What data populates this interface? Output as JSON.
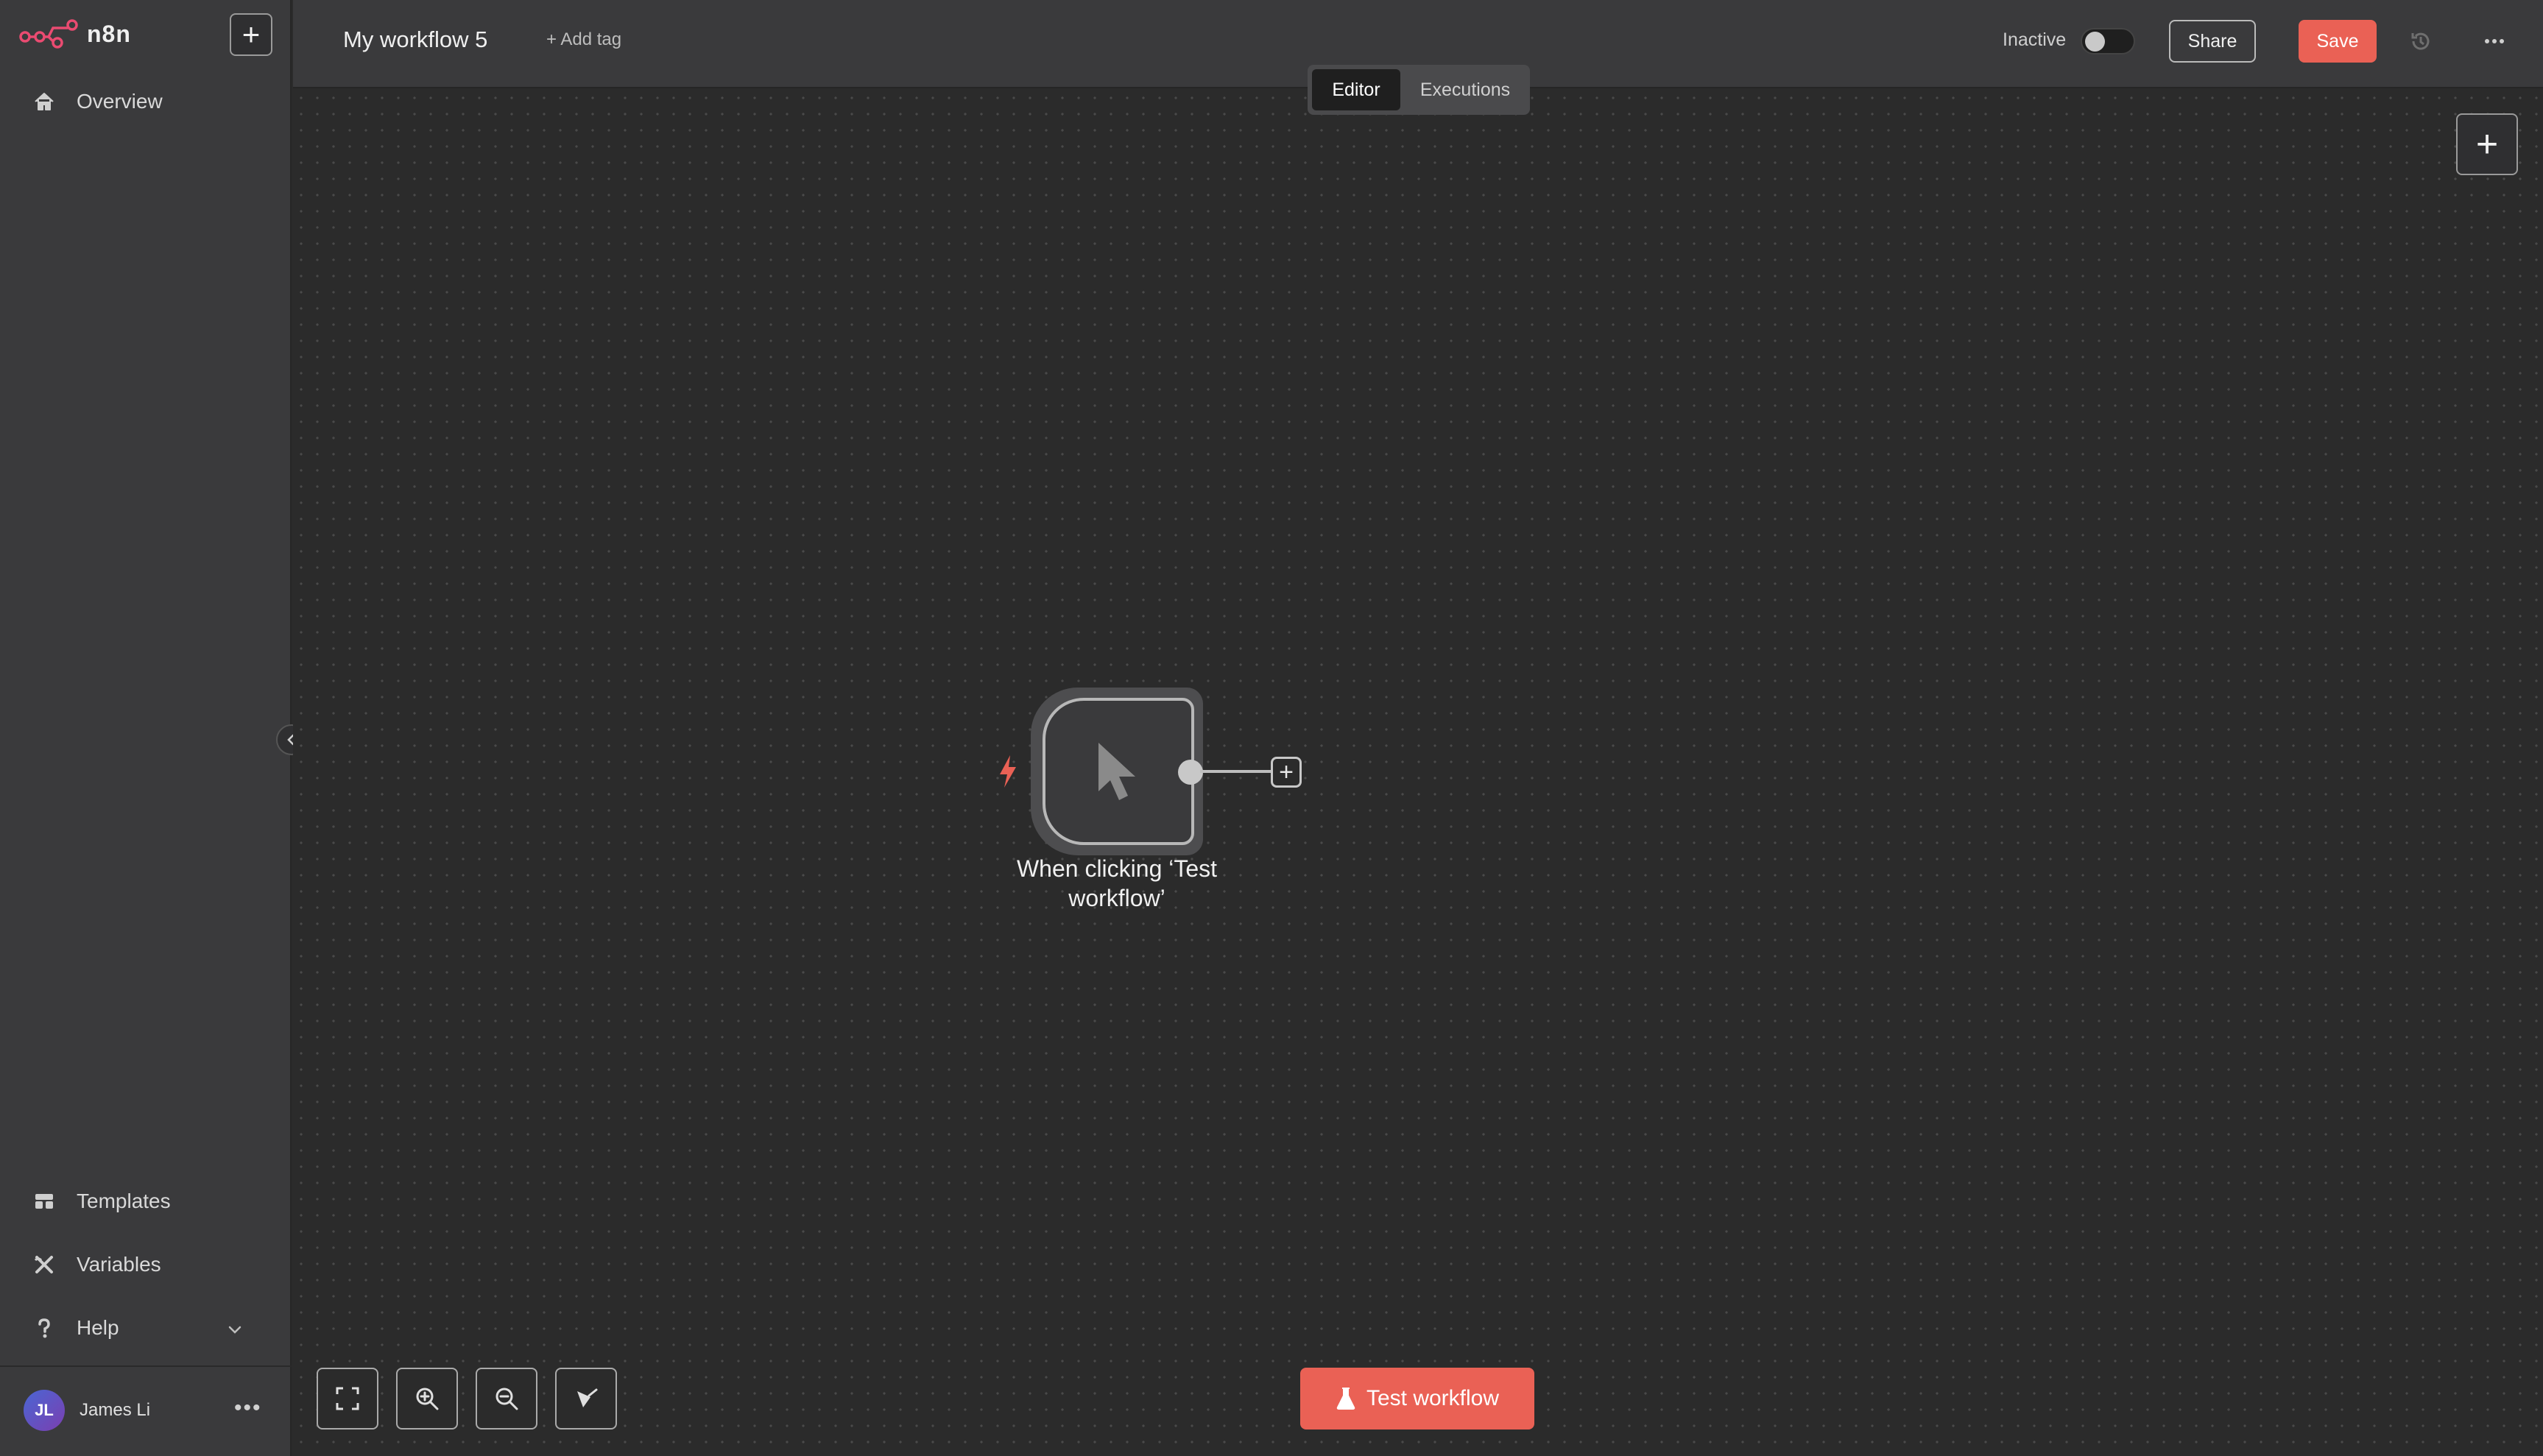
{
  "app": {
    "brand": "n8n",
    "accent_color": "#ea6155"
  },
  "sidebar": {
    "overview": "Overview",
    "bottom_items": [
      {
        "label": "Templates",
        "icon": "templates-icon"
      },
      {
        "label": "Variables",
        "icon": "variables-icon"
      },
      {
        "label": "Help",
        "icon": "help-icon"
      }
    ],
    "user": {
      "initials": "JL",
      "name": "James Li"
    }
  },
  "header": {
    "workflow_title": "My workflow 5",
    "add_tag": "+ Add tag",
    "status_label": "Inactive",
    "active": false,
    "share_label": "Share",
    "save_label": "Save",
    "tabs": [
      {
        "label": "Editor",
        "active": true
      },
      {
        "label": "Executions",
        "active": false
      }
    ]
  },
  "canvas": {
    "node": {
      "label": "When clicking ‘Test workflow’",
      "type": "manual-trigger",
      "icon": "cursor-icon"
    },
    "test_button_label": "Test workflow"
  }
}
